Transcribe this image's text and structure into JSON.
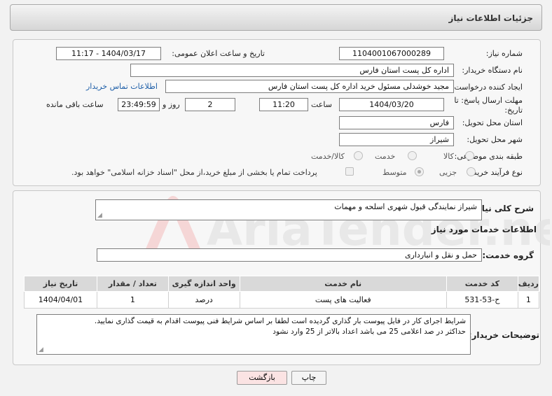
{
  "header": {
    "title": "جزئیات اطلاعات نیاز"
  },
  "form": {
    "need_number_label": "شماره نیاز:",
    "need_number": "1104001067000289",
    "announce_label": "تاریخ و ساعت اعلان عمومی:",
    "announce_value": "1404/03/17 - 11:17",
    "buyer_org_label": "نام دستگاه خریدار:",
    "buyer_org": "اداره کل پست استان فارس",
    "requester_label": "ایجاد کننده درخواست:",
    "requester": "مجید خوشدلی مسئول خرید اداره کل پست استان فارس",
    "buyer_contact_link": "اطلاعات تماس خریدار",
    "deadline_label_1": "مهلت ارسال پاسخ: تا",
    "deadline_label_2": "تاریخ:",
    "deadline_date": "1404/03/20",
    "time_label": "ساعت",
    "deadline_time": "11:20",
    "days_value": "2",
    "days_label": "روز و",
    "remaining_time": "23:49:59",
    "remaining_label": "ساعت باقی مانده",
    "province_label": "استان محل تحویل:",
    "province": "فارس",
    "city_label": "شهر محل تحویل:",
    "city": "شیراز",
    "category_label": "طبقه بندی موضوعی:",
    "category_options": [
      "کالا",
      "خدمت",
      "کالا/خدمت"
    ],
    "process_label": "نوع فرآیند خرید :",
    "process_options": [
      "جزیی",
      "متوسط"
    ],
    "payment_note": "پرداخت تمام یا بخشی از مبلغ خرید،از محل \"اسناد خزانه اسلامی\" خواهد بود."
  },
  "details": {
    "summary_label": "شرح کلی نیاز:",
    "summary": "شیراز نمایندگی قبول شهری اسلحه و مهمات",
    "services_title": "اطلاعات خدمات مورد نیاز",
    "service_group_label": "گروه خدمت:",
    "service_group": "حمل و نقل و انبارداری"
  },
  "table": {
    "headers": [
      "ردیف",
      "کد خدمت",
      "نام خدمت",
      "واحد اندازه گیری",
      "تعداد / مقدار",
      "تاریخ نیاز"
    ],
    "rows": [
      [
        "1",
        "ح-53-531",
        "فعالیت های پست",
        "درصد",
        "1",
        "1404/04/01"
      ]
    ]
  },
  "buyer_notes": {
    "label": "توضیحات خریدار:",
    "line1": "شرایط اجرای کار در فایل پیوست بار گذاری گردیده است لطفا بر اساس شرایط فنی پیوست اقدام به قیمت گذاری نمایید.",
    "line2": "حداکثر در صد اعلامی 25 می باشد اعداد بالاتر از 25 وارد نشود"
  },
  "buttons": {
    "print": "چاپ",
    "back": "بازگشت"
  },
  "watermark": {
    "brand": "AriaTender.neT"
  }
}
